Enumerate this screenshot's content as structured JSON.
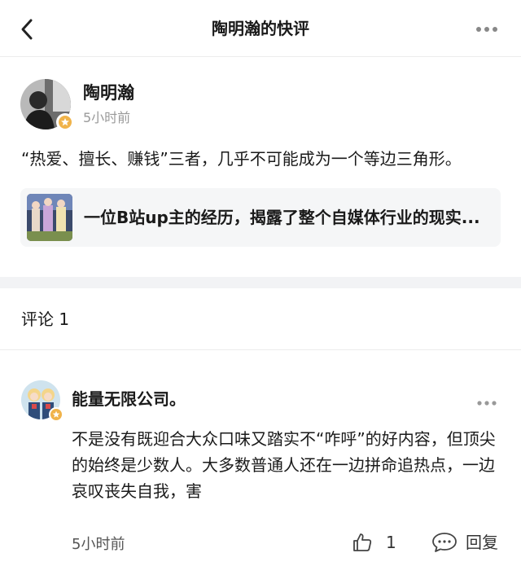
{
  "header": {
    "title": "陶明瀚的快评",
    "back_icon": "chevron-left-icon",
    "more_icon": "more-dots-icon"
  },
  "post": {
    "author": "陶明瀚",
    "time": "5小时前",
    "content": "“热爱、擅长、赚钱”三者，几乎不可能成为一个等边三角形。",
    "link_card": {
      "title": "一位B站up主的经历，揭露了整个自媒体行业的现实..."
    }
  },
  "comments_section": {
    "label": "评论 1"
  },
  "comment": {
    "author": "能量无限公司。",
    "text": "不是没有既迎合大众口味又踏实不“咋呼”的好内容，但顶尖的始终是少数人。大多数普通人还在一边拼命追热点，一边哀叹丧失自我，害",
    "time": "5小时前",
    "like_count": "1",
    "reply_label": "回复"
  },
  "colors": {
    "gray_text": "#9a9a9a",
    "divider": "#ececec",
    "card_bg": "#f5f6f7",
    "badge_star": "#f0b34a"
  }
}
